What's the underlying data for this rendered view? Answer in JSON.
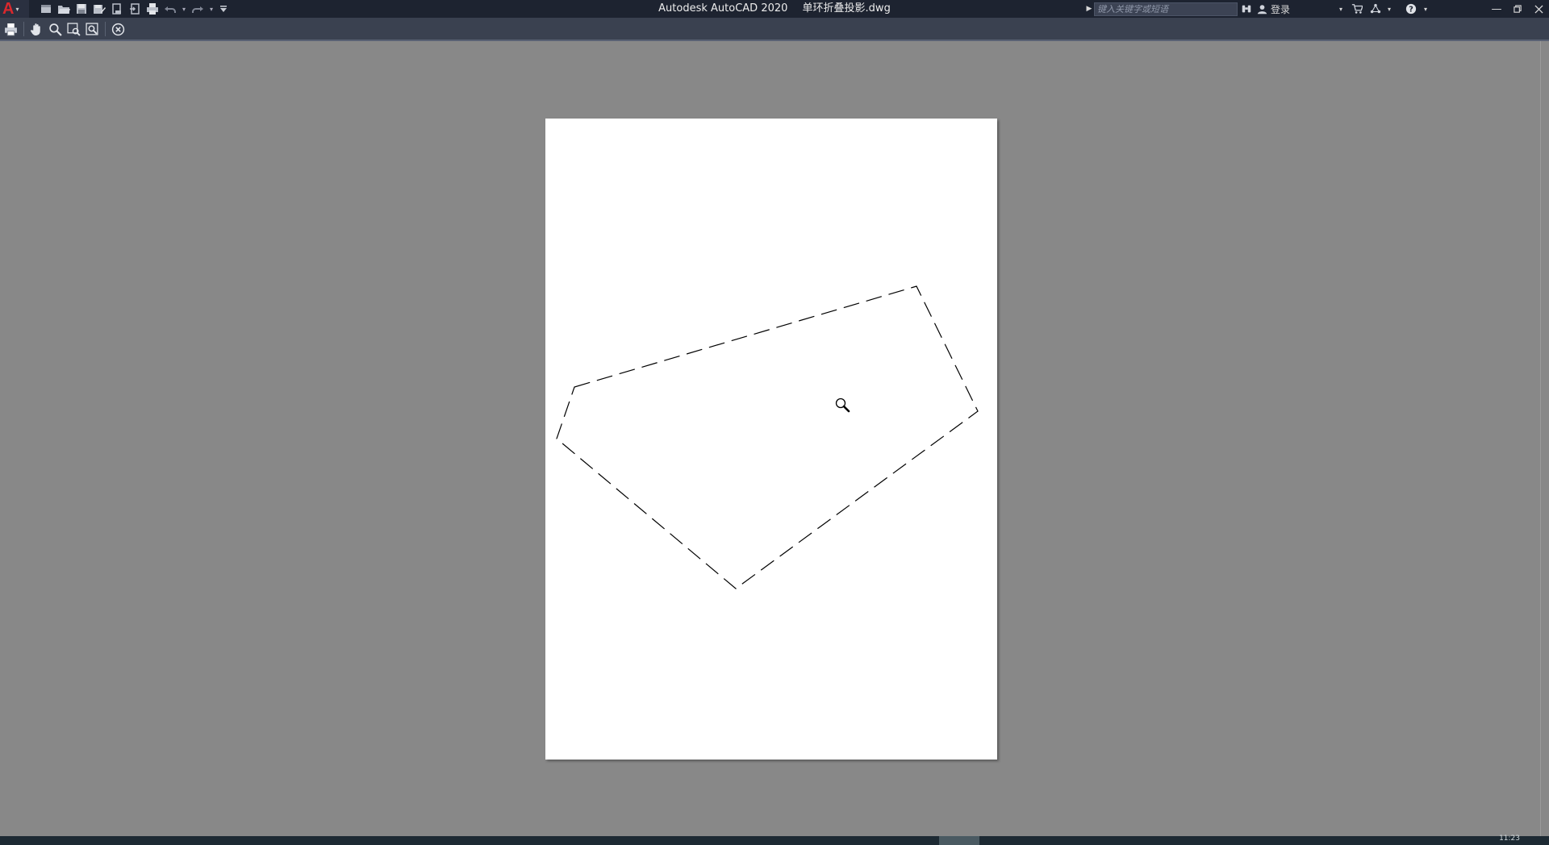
{
  "window": {
    "app_title": "Autodesk AutoCAD 2020",
    "file_name": "单环折叠投影.dwg"
  },
  "search": {
    "placeholder": "键入关键字或短语"
  },
  "user": {
    "login_label": "登录"
  },
  "status": {
    "clock": "11:23"
  },
  "colors": {
    "title_bar": "#1d2330",
    "toolbar": "#3a4150",
    "canvas": "#888888",
    "paper": "#ffffff",
    "logo_accent": "#d9282d"
  },
  "icons": {
    "quick_access": [
      "new-icon",
      "open-icon",
      "save-icon",
      "save-as-icon",
      "open-from-web-icon",
      "save-to-web-icon",
      "plot-icon",
      "undo-icon",
      "redo-icon",
      "customize-icon"
    ],
    "preview_toolbar": [
      "plot-icon",
      "pan-icon",
      "zoom-realtime-icon",
      "zoom-window-icon",
      "zoom-original-icon",
      "close-preview-icon"
    ]
  }
}
